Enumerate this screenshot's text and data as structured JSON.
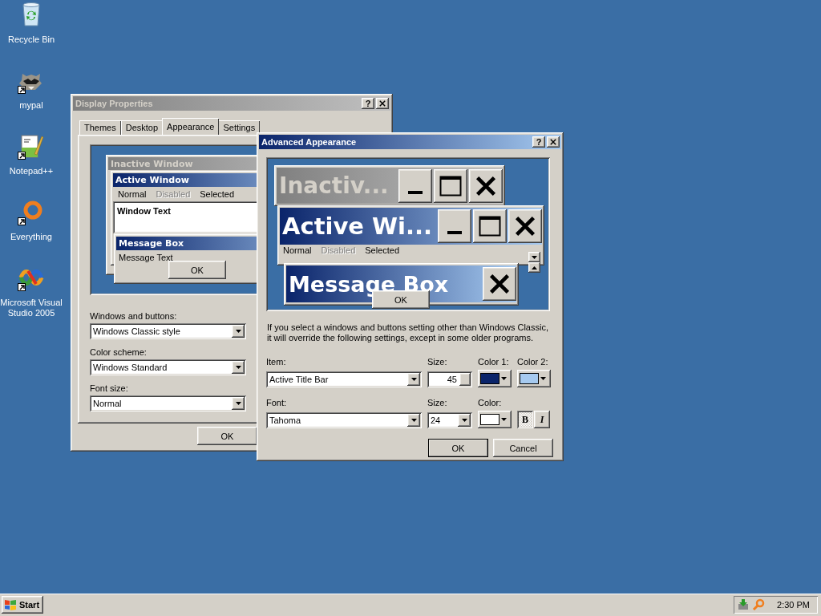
{
  "desktop_icons": [
    {
      "kind": "recycle-bin",
      "label": "Recycle Bin",
      "shortcut": false
    },
    {
      "kind": "raccoon",
      "label": "mypal",
      "shortcut": true
    },
    {
      "kind": "notepad",
      "label": "Notepad++",
      "shortcut": true
    },
    {
      "kind": "ring",
      "label": "Everything",
      "shortcut": true
    },
    {
      "kind": "ribbon",
      "label": "Microsoft Visual Studio 2005",
      "shortcut": true
    }
  ],
  "display_properties": {
    "title": "Display Properties",
    "active": false,
    "help": "?",
    "tabs": [
      {
        "label": "Themes",
        "selected": false
      },
      {
        "label": "Desktop",
        "selected": false
      },
      {
        "label": "Appearance",
        "selected": true
      },
      {
        "label": "Settings",
        "selected": false
      }
    ],
    "preview": {
      "inactive_title": "Inactive Window",
      "active_title": "Active Window",
      "menu": [
        {
          "label": "Normal",
          "disabled": false
        },
        {
          "label": "Disabled",
          "disabled": true
        },
        {
          "label": "Selected",
          "disabled": false
        }
      ],
      "window_text": "Window Text",
      "message_title": "Message Box",
      "message_text": "Message Text",
      "ok": "OK"
    },
    "fields": [
      {
        "label": "Windows and buttons:",
        "value": "Windows Classic style"
      },
      {
        "label": "Color scheme:",
        "value": "Windows Standard"
      },
      {
        "label": "Font size:",
        "value": "Normal"
      }
    ],
    "buttons": [
      "OK"
    ]
  },
  "advanced_appearance": {
    "title": "Advanced Appearance",
    "active": true,
    "help": "?",
    "preview": {
      "inactive_title": "Inactiv...",
      "active_title": "Active Wi...",
      "menu": [
        {
          "label": "Normal",
          "disabled": false
        },
        {
          "label": "Disabled",
          "disabled": true
        },
        {
          "label": "Selected",
          "disabled": false
        }
      ],
      "message_title": "Message Box",
      "ok": "OK"
    },
    "note": "If you select a windows and buttons setting other than Windows Classic, it will override the following settings, except in some older programs.",
    "item_row": {
      "item": {
        "label": "Item:",
        "value": "Active Title Bar"
      },
      "size": {
        "label": "Size:",
        "value": "45"
      },
      "colors": [
        {
          "label": "Color 1:",
          "color": "#0a246a"
        },
        {
          "label": "Color 2:",
          "color": "#a6caf0"
        }
      ]
    },
    "font_row": {
      "font": {
        "label": "Font:",
        "value": "Tahoma"
      },
      "size": {
        "label": "Size:",
        "value": "24"
      },
      "color": {
        "label": "Color:",
        "color": "#ffffff"
      },
      "bold": {
        "label": "B",
        "pressed": true
      },
      "italic": {
        "label": "I",
        "pressed": false
      }
    },
    "buttons": [
      {
        "label": "OK",
        "default": true
      },
      {
        "label": "Cancel",
        "default": false
      }
    ]
  },
  "taskbar": {
    "start": "Start",
    "clock": "2:30 PM"
  }
}
